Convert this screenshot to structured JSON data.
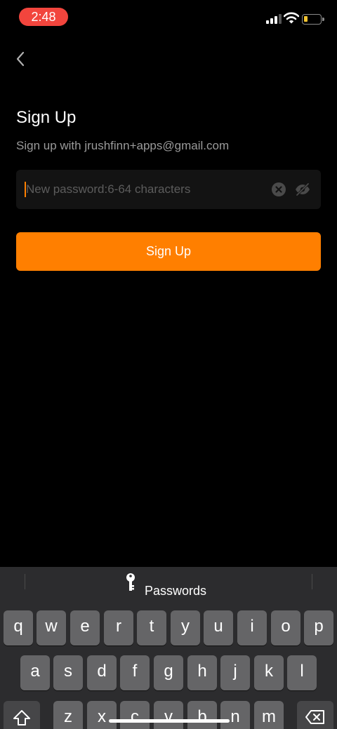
{
  "status_bar": {
    "time": "2:48",
    "battery_color": "#f4c531",
    "time_pill_color": "#f2453d",
    "icons": [
      "cellular-signal-icon",
      "wifi-icon",
      "battery-icon"
    ]
  },
  "nav": {
    "back_icon": "chevron-left-icon"
  },
  "header": {
    "title": "Sign Up",
    "subtitle": "Sign up with jrushfinn+apps@gmail.com"
  },
  "password_field": {
    "value": "",
    "placeholder": "New password:6-64 characters",
    "clear_icon": "clear-circle-icon",
    "visibility_icon": "eye-slash-icon"
  },
  "actions": {
    "signup_label": "Sign Up",
    "accent_color": "#ff7f00"
  },
  "keyboard": {
    "suggestion_label": "Passwords",
    "suggestion_icon": "key-icon",
    "row1": [
      "q",
      "w",
      "e",
      "r",
      "t",
      "y",
      "u",
      "i",
      "o",
      "p"
    ],
    "row2": [
      "a",
      "s",
      "d",
      "f",
      "g",
      "h",
      "j",
      "k",
      "l"
    ],
    "row3": [
      "z",
      "x",
      "c",
      "v",
      "b",
      "n",
      "m"
    ],
    "shift_icon": "shift-icon",
    "delete_icon": "delete-backspace-icon"
  }
}
